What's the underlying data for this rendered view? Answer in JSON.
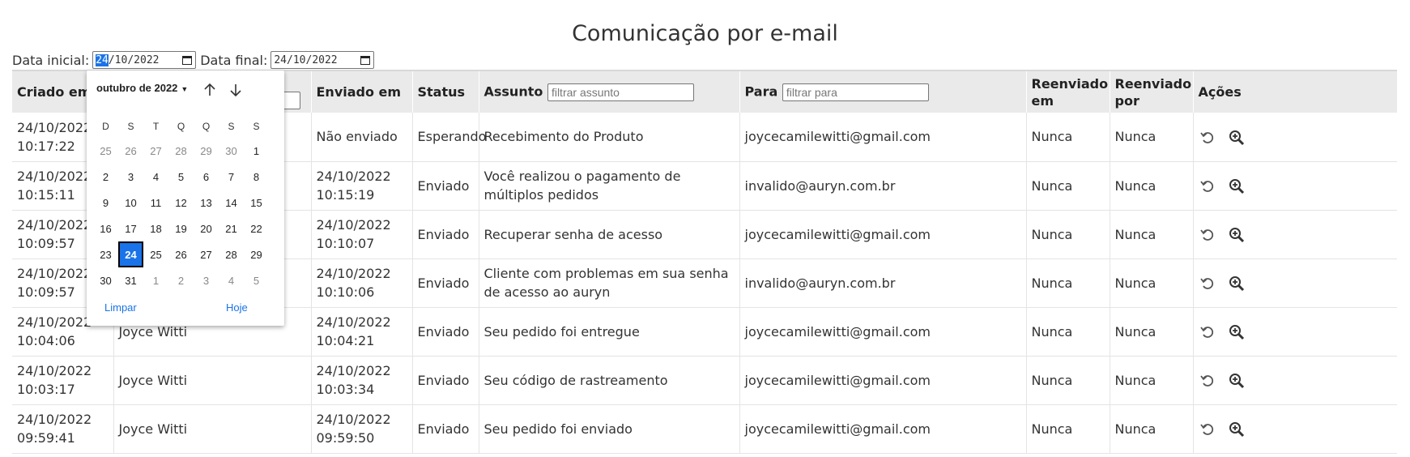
{
  "page": {
    "title": "Comunicação por e-mail"
  },
  "filters": {
    "start_label": "Data inicial:",
    "start_day": "24",
    "start_rest": "/10/2022",
    "end_label": "Data final:",
    "end_value": "24/10/2022"
  },
  "table": {
    "headers": {
      "created": "Criado em",
      "sent": "Enviado em",
      "status": "Status",
      "subject": "Assunto",
      "subject_placeholder": "filtrar assunto",
      "to": "Para",
      "to_placeholder": "filtrar para",
      "resent_at": "Reenviado em",
      "resent_by": "Reenviado por",
      "actions": "Ações"
    },
    "rows": [
      {
        "created_date": "24/10/2022",
        "created_time": "10:17:22",
        "name": "",
        "sent_date": "Não enviado",
        "sent_time": "",
        "status": "Esperando",
        "subject": "Recebimento do Produto",
        "to": "joycecamilewitti@gmail.com",
        "resent_at": "Nunca",
        "resent_by": "Nunca"
      },
      {
        "created_date": "24/10/2022",
        "created_time": "10:15:11",
        "name": "",
        "sent_date": "24/10/2022",
        "sent_time": "10:15:19",
        "status": "Enviado",
        "subject": "Você realizou o pagamento de múltiplos pedidos",
        "to": "invalido@auryn.com.br",
        "resent_at": "Nunca",
        "resent_by": "Nunca"
      },
      {
        "created_date": "24/10/2022",
        "created_time": "10:09:57",
        "name": "",
        "sent_date": "24/10/2022",
        "sent_time": "10:10:07",
        "status": "Enviado",
        "subject": "Recuperar senha de acesso",
        "to": "joycecamilewitti@gmail.com",
        "resent_at": "Nunca",
        "resent_by": "Nunca"
      },
      {
        "created_date": "24/10/2022",
        "created_time": "10:09:57",
        "name": "",
        "sent_date": "24/10/2022",
        "sent_time": "10:10:06",
        "status": "Enviado",
        "subject": "Cliente com problemas em sua senha de acesso ao auryn",
        "to": "invalido@auryn.com.br",
        "resent_at": "Nunca",
        "resent_by": "Nunca"
      },
      {
        "created_date": "24/10/2022",
        "created_time": "10:04:06",
        "name": "Joyce Witti",
        "sent_date": "24/10/2022",
        "sent_time": "10:04:21",
        "status": "Enviado",
        "subject": "Seu pedido foi entregue",
        "to": "joycecamilewitti@gmail.com",
        "resent_at": "Nunca",
        "resent_by": "Nunca"
      },
      {
        "created_date": "24/10/2022",
        "created_time": "10:03:17",
        "name": "Joyce Witti",
        "sent_date": "24/10/2022",
        "sent_time": "10:03:34",
        "status": "Enviado",
        "subject": "Seu código de rastreamento",
        "to": "joycecamilewitti@gmail.com",
        "resent_at": "Nunca",
        "resent_by": "Nunca"
      },
      {
        "created_date": "24/10/2022",
        "created_time": "09:59:41",
        "name": "Joyce Witti",
        "sent_date": "24/10/2022",
        "sent_time": "09:59:50",
        "status": "Enviado",
        "subject": "Seu pedido foi enviado",
        "to": "joycecamilewitti@gmail.com",
        "resent_at": "Nunca",
        "resent_by": "Nunca"
      }
    ],
    "action_icons": [
      "resend-icon",
      "zoom-in-icon"
    ]
  },
  "calendar": {
    "month_label": "outubro de 2022",
    "weekdays": [
      "D",
      "S",
      "T",
      "Q",
      "Q",
      "S",
      "S"
    ],
    "weeks": [
      [
        {
          "d": "25",
          "m": true
        },
        {
          "d": "26",
          "m": true
        },
        {
          "d": "27",
          "m": true
        },
        {
          "d": "28",
          "m": true
        },
        {
          "d": "29",
          "m": true
        },
        {
          "d": "30",
          "m": true
        },
        {
          "d": "1"
        }
      ],
      [
        {
          "d": "2"
        },
        {
          "d": "3"
        },
        {
          "d": "4"
        },
        {
          "d": "5"
        },
        {
          "d": "6"
        },
        {
          "d": "7"
        },
        {
          "d": "8"
        }
      ],
      [
        {
          "d": "9"
        },
        {
          "d": "10"
        },
        {
          "d": "11"
        },
        {
          "d": "12"
        },
        {
          "d": "13"
        },
        {
          "d": "14"
        },
        {
          "d": "15"
        }
      ],
      [
        {
          "d": "16"
        },
        {
          "d": "17"
        },
        {
          "d": "18"
        },
        {
          "d": "19"
        },
        {
          "d": "20"
        },
        {
          "d": "21"
        },
        {
          "d": "22"
        }
      ],
      [
        {
          "d": "23"
        },
        {
          "d": "24",
          "s": true
        },
        {
          "d": "25"
        },
        {
          "d": "26"
        },
        {
          "d": "27"
        },
        {
          "d": "28"
        },
        {
          "d": "29"
        }
      ],
      [
        {
          "d": "30"
        },
        {
          "d": "31"
        },
        {
          "d": "1",
          "m": true
        },
        {
          "d": "2",
          "m": true
        },
        {
          "d": "3",
          "m": true
        },
        {
          "d": "4",
          "m": true
        },
        {
          "d": "5",
          "m": true
        }
      ]
    ],
    "clear_label": "Limpar",
    "today_label": "Hoje"
  },
  "colors": {
    "accent": "#1a73e8",
    "header_bg": "#eaeaea",
    "icon": "#555555"
  }
}
